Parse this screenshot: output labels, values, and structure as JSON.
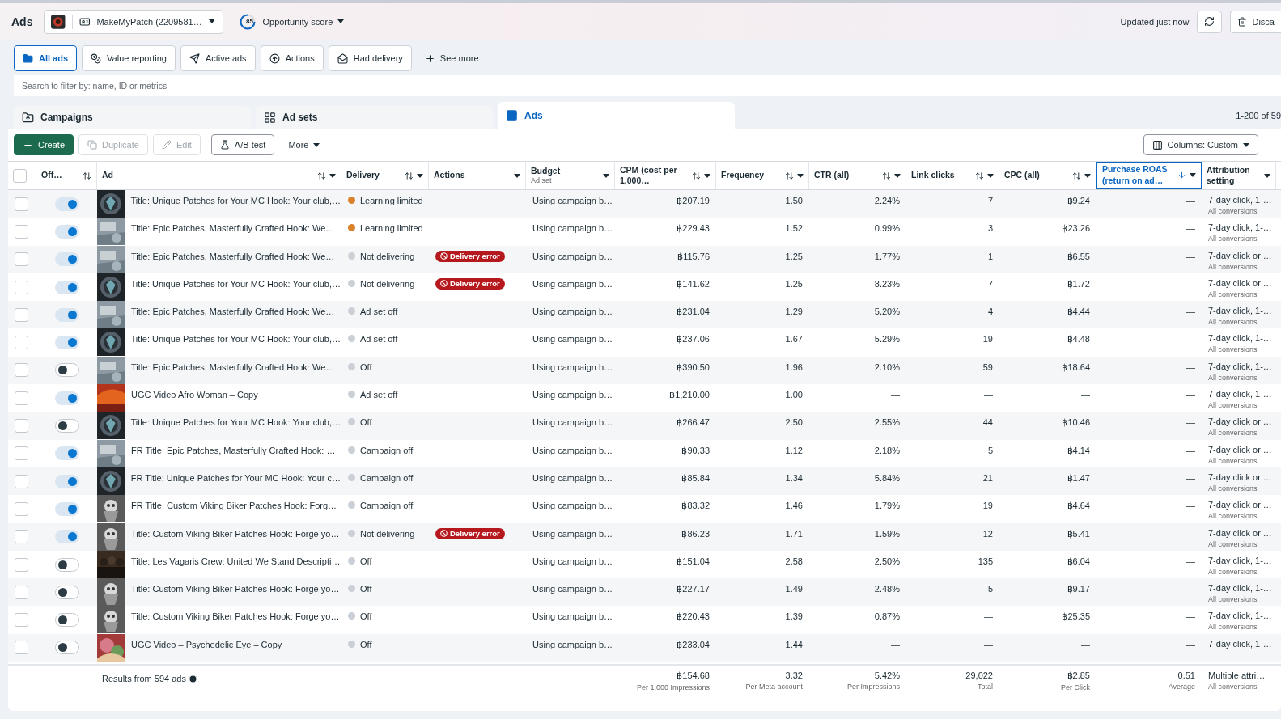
{
  "header": {
    "title": "Ads",
    "account": "MakeMyPatch (2209581…",
    "score": "85",
    "score_label": "Opportunity score",
    "updated": "Updated just now",
    "discard": "Disca"
  },
  "filters": [
    {
      "label": "All ads",
      "selected": true
    },
    {
      "label": "Value reporting",
      "selected": false
    },
    {
      "label": "Active ads",
      "selected": false
    },
    {
      "label": "Actions",
      "selected": false
    },
    {
      "label": "Had delivery",
      "selected": false
    }
  ],
  "see_more": "See more",
  "search": {
    "placeholder": "Search to filter by: name, ID or metrics"
  },
  "levels": [
    {
      "label": "Campaigns",
      "selected": false
    },
    {
      "label": "Ad sets",
      "selected": false
    },
    {
      "label": "Ads",
      "selected": true
    }
  ],
  "range": "1-200 of 59",
  "toolbar": {
    "create": "Create",
    "duplicate": {
      "label": "Duplicate",
      "disabled": true
    },
    "edit": {
      "label": "Edit",
      "disabled": true
    },
    "ab_test": "A/B test",
    "more": "More",
    "columns": "Columns: Custom"
  },
  "select_all": {
    "checked": false
  },
  "columns": [
    {
      "label": "Off…",
      "sortable": true,
      "menu": false,
      "active": false
    },
    {
      "label": "Ad",
      "sortable": true,
      "menu": true,
      "active": false
    },
    {
      "label": "Delivery",
      "sortable": true,
      "menu": true,
      "active": false
    },
    {
      "label": "Actions",
      "sortable": false,
      "menu": true,
      "active": false
    },
    {
      "label": "Budget",
      "sub": "Ad set",
      "sortable": false,
      "menu": true,
      "active": false
    },
    {
      "label": "CPM (cost per 1,000…",
      "sortable": true,
      "menu": true,
      "active": false
    },
    {
      "label": "Frequency",
      "sortable": true,
      "menu": true,
      "active": false
    },
    {
      "label": "CTR (all)",
      "sortable": true,
      "menu": true,
      "active": false
    },
    {
      "label": "Link clicks",
      "sortable": true,
      "menu": true,
      "active": false
    },
    {
      "label": "CPC (all)",
      "sortable": true,
      "menu": true,
      "active": false
    },
    {
      "label": "Purchase ROAS (return on ad…",
      "sortable": true,
      "menu": true,
      "active": true
    },
    {
      "label": "Attribution setting",
      "sortable": false,
      "menu": true,
      "active": false
    }
  ],
  "rows": [
    {
      "checked": false,
      "on": true,
      "ad": "Title: Unique Patches for Your MC Hook: Your club,…",
      "delivery": "Learning limited",
      "color": "#d9822b",
      "budget": "Using campaign b…",
      "cpm": "฿207.19",
      "frequency": "1.50",
      "ctr": "2.24%",
      "clicks": "7",
      "cpc": "฿9.24",
      "roas": "—",
      "attribution": "7-day click, 1-…",
      "attribution_sub": "All conversions"
    },
    {
      "checked": false,
      "on": true,
      "ad": "Title: Epic Patches, Masterfully Crafted Hook: We…",
      "delivery": "Learning limited",
      "color": "#d9822b",
      "budget": "Using campaign b…",
      "cpm": "฿229.43",
      "frequency": "1.52",
      "ctr": "0.99%",
      "clicks": "3",
      "cpc": "฿23.26",
      "roas": "—",
      "attribution": "7-day click, 1-…",
      "attribution_sub": "All conversions"
    },
    {
      "checked": false,
      "on": true,
      "ad": "Title: Epic Patches, Masterfully Crafted Hook: We…",
      "delivery": "Not delivering",
      "color": "#cbd0d6",
      "error": "Delivery error",
      "budget": "Using campaign b…",
      "cpm": "฿115.76",
      "frequency": "1.25",
      "ctr": "1.77%",
      "clicks": "1",
      "cpc": "฿6.55",
      "roas": "—",
      "attribution": "7-day click or …",
      "attribution_sub": "All conversions"
    },
    {
      "checked": false,
      "on": true,
      "ad": "Title: Unique Patches for Your MC Hook: Your club,…",
      "delivery": "Not delivering",
      "color": "#cbd0d6",
      "error": "Delivery error",
      "budget": "Using campaign b…",
      "cpm": "฿141.62",
      "frequency": "1.25",
      "ctr": "8.23%",
      "clicks": "7",
      "cpc": "฿1.72",
      "roas": "—",
      "attribution": "7-day click or …",
      "attribution_sub": "All conversions"
    },
    {
      "checked": false,
      "on": true,
      "ad": "Title: Epic Patches, Masterfully Crafted Hook: We…",
      "delivery": "Ad set off",
      "color": "#cbd0d6",
      "budget": "Using campaign b…",
      "cpm": "฿231.04",
      "frequency": "1.29",
      "ctr": "5.20%",
      "clicks": "4",
      "cpc": "฿4.44",
      "roas": "—",
      "attribution": "7-day click, 1-…",
      "attribution_sub": "All conversions"
    },
    {
      "checked": false,
      "on": true,
      "ad": "Title: Unique Patches for Your MC Hook: Your club,…",
      "delivery": "Ad set off",
      "color": "#cbd0d6",
      "budget": "Using campaign b…",
      "cpm": "฿237.06",
      "frequency": "1.67",
      "ctr": "5.29%",
      "clicks": "19",
      "cpc": "฿4.48",
      "roas": "—",
      "attribution": "7-day click, 1-…",
      "attribution_sub": "All conversions"
    },
    {
      "checked": false,
      "on": false,
      "ad": "Title: Epic Patches, Masterfully Crafted Hook: We…",
      "delivery": "Off",
      "color": "#cbd0d6",
      "budget": "Using campaign b…",
      "cpm": "฿390.50",
      "frequency": "1.96",
      "ctr": "2.10%",
      "clicks": "59",
      "cpc": "฿18.64",
      "roas": "—",
      "attribution": "7-day click, 1-…",
      "attribution_sub": "All conversions"
    },
    {
      "checked": false,
      "on": true,
      "ad": "UGC Video Afro Woman – Copy",
      "delivery": "Ad set off",
      "color": "#cbd0d6",
      "budget": "Using campaign b…",
      "cpm": "฿1,210.00",
      "frequency": "1.00",
      "ctr": "—",
      "clicks": "—",
      "cpc": "—",
      "roas": "—",
      "attribution": "7-day click, 1-…",
      "attribution_sub": "All conversions"
    },
    {
      "checked": false,
      "on": false,
      "ad": "Title: Unique Patches for Your MC Hook: Your club,…",
      "delivery": "Off",
      "color": "#cbd0d6",
      "budget": "Using campaign b…",
      "cpm": "฿266.47",
      "frequency": "2.50",
      "ctr": "2.55%",
      "clicks": "44",
      "cpc": "฿10.46",
      "roas": "—",
      "attribution": "7-day click or …",
      "attribution_sub": "All conversions"
    },
    {
      "checked": false,
      "on": true,
      "ad": "FR Title: Epic Patches, Masterfully Crafted Hook: …",
      "delivery": "Campaign off",
      "color": "#cbd0d6",
      "budget": "Using campaign b…",
      "cpm": "฿90.33",
      "frequency": "1.12",
      "ctr": "2.18%",
      "clicks": "5",
      "cpc": "฿4.14",
      "roas": "—",
      "attribution": "7-day click or …",
      "attribution_sub": "All conversions"
    },
    {
      "checked": false,
      "on": true,
      "ad": "FR Title: Unique Patches for Your MC Hook: Your c…",
      "delivery": "Campaign off",
      "color": "#cbd0d6",
      "budget": "Using campaign b…",
      "cpm": "฿85.84",
      "frequency": "1.34",
      "ctr": "5.84%",
      "clicks": "21",
      "cpc": "฿1.47",
      "roas": "—",
      "attribution": "7-day click or …",
      "attribution_sub": "All conversions"
    },
    {
      "checked": false,
      "on": true,
      "ad": "FR Title: Custom Viking Biker Patches Hook: Forg…",
      "delivery": "Campaign off",
      "color": "#cbd0d6",
      "budget": "Using campaign b…",
      "cpm": "฿83.32",
      "frequency": "1.46",
      "ctr": "1.79%",
      "clicks": "19",
      "cpc": "฿4.64",
      "roas": "—",
      "attribution": "7-day click or …",
      "attribution_sub": "All conversions"
    },
    {
      "checked": false,
      "on": true,
      "ad": "Title: Custom Viking Biker Patches Hook: Forge yo…",
      "delivery": "Not delivering",
      "color": "#cbd0d6",
      "error": "Delivery error",
      "budget": "Using campaign b…",
      "cpm": "฿86.23",
      "frequency": "1.71",
      "ctr": "1.59%",
      "clicks": "12",
      "cpc": "฿5.41",
      "roas": "—",
      "attribution": "7-day click or …",
      "attribution_sub": "All conversions"
    },
    {
      "checked": false,
      "on": false,
      "ad": "Title: Les Vagaris Crew: United We Stand Descripti…",
      "delivery": "Off",
      "color": "#cbd0d6",
      "budget": "Using campaign b…",
      "cpm": "฿151.04",
      "frequency": "2.58",
      "ctr": "2.50%",
      "clicks": "135",
      "cpc": "฿6.04",
      "roas": "—",
      "attribution": "7-day click, 1-…",
      "attribution_sub": "All conversions"
    },
    {
      "checked": false,
      "on": false,
      "ad": "Title: Custom Viking Biker Patches Hook: Forge yo…",
      "delivery": "Off",
      "color": "#cbd0d6",
      "budget": "Using campaign b…",
      "cpm": "฿227.17",
      "frequency": "1.49",
      "ctr": "2.48%",
      "clicks": "5",
      "cpc": "฿9.17",
      "roas": "—",
      "attribution": "7-day click, 1-…",
      "attribution_sub": "All conversions"
    },
    {
      "checked": false,
      "on": false,
      "ad": "Title: Custom Viking Biker Patches Hook: Forge yo…",
      "delivery": "Off",
      "color": "#cbd0d6",
      "budget": "Using campaign b…",
      "cpm": "฿220.43",
      "frequency": "1.39",
      "ctr": "0.87%",
      "clicks": "—",
      "cpc": "฿25.35",
      "roas": "—",
      "attribution": "7-day click, 1-…",
      "attribution_sub": "All conversions"
    },
    {
      "checked": false,
      "on": false,
      "ad": "UGC Video – Psychedelic Eye – Copy",
      "delivery": "Off",
      "color": "#cbd0d6",
      "budget": "Using campaign b…",
      "cpm": "฿233.04",
      "frequency": "1.44",
      "ctr": "—",
      "clicks": "—",
      "cpc": "—",
      "roas": "—",
      "attribution": "7-day click, 1-…"
    }
  ],
  "footer": {
    "results": "Results from 594 ads",
    "totals": [
      {
        "value": "฿154.68",
        "sub": "Per 1,000 Impressions"
      },
      {
        "value": "3.32",
        "sub": "Per Meta account"
      },
      {
        "value": "5.42%",
        "sub": "Per Impressions"
      },
      {
        "value": "29,022",
        "sub": "Total"
      },
      {
        "value": "฿2.85",
        "sub": "Per Click"
      },
      {
        "value": "0.51",
        "sub": "Average"
      },
      {
        "value": "Multiple attri…",
        "sub": "All conversions"
      }
    ]
  }
}
